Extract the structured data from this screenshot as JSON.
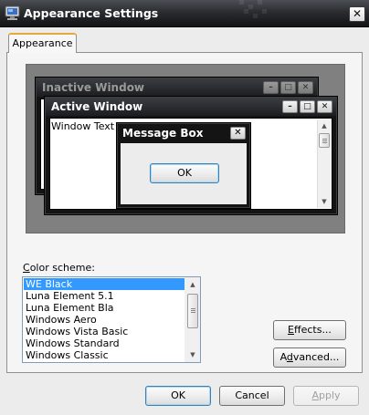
{
  "dialog": {
    "title": "Appearance Settings",
    "close_glyph": "✕"
  },
  "tabs": [
    {
      "label": "Appearance"
    }
  ],
  "preview": {
    "inactive_window": {
      "title": "Inactive Window"
    },
    "active_window": {
      "title": "Active Window",
      "text": "Window Text"
    },
    "message_box": {
      "title": "Message Box",
      "ok_label": "OK"
    },
    "caption_glyphs": {
      "minimize": "–",
      "maximize": "□",
      "close": "✕"
    }
  },
  "color_scheme": {
    "label_accel": "C",
    "label_rest": "olor scheme:",
    "items": [
      {
        "label": "WE Black",
        "selected": true
      },
      {
        "label": "Luna Element 5.1",
        "selected": false
      },
      {
        "label": "Luna Element Bla",
        "selected": false
      },
      {
        "label": "Windows Aero",
        "selected": false
      },
      {
        "label": "Windows Vista Basic",
        "selected": false
      },
      {
        "label": "Windows Standard",
        "selected": false
      },
      {
        "label": "Windows Classic",
        "selected": false
      }
    ]
  },
  "buttons": {
    "effects_accel": "E",
    "effects_rest": "ffects...",
    "advanced_pre": "A",
    "advanced_accel": "d",
    "advanced_rest": "vanced...",
    "ok": "OK",
    "cancel": "Cancel",
    "apply_accel": "A",
    "apply_rest": "pply"
  },
  "colors": {
    "titlebar": "#1c1d20",
    "selection": "#3399ff",
    "tab_accent": "#e9a93a",
    "preview_background": "#808080"
  }
}
